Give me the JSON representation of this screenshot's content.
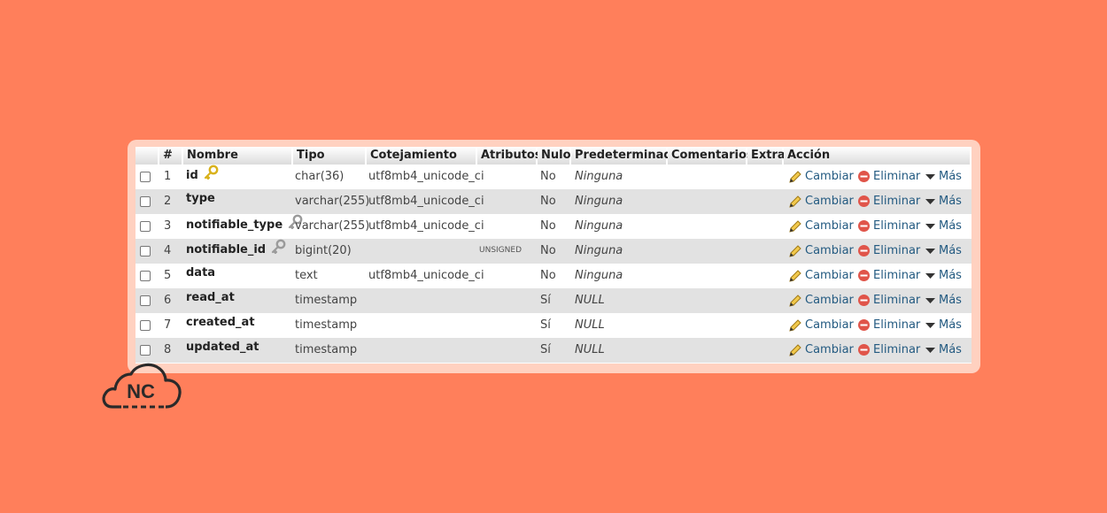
{
  "headers": {
    "hash": "#",
    "nombre": "Nombre",
    "tipo": "Tipo",
    "cotejamiento": "Cotejamiento",
    "atributos": "Atributos",
    "nulo": "Nulo",
    "predeterminado": "Predeterminado",
    "comentarios": "Comentarios",
    "extra": "Extra",
    "accion": "Acción"
  },
  "actions": {
    "cambiar": "Cambiar",
    "eliminar": "Eliminar",
    "mas": "Más"
  },
  "rows": [
    {
      "num": "1",
      "name": "id",
      "tipo": "char(36)",
      "cotejamiento": "utf8mb4_unicode_ci",
      "atributos": "",
      "nulo": "No",
      "predeterminado": "Ninguna",
      "key": "primary"
    },
    {
      "num": "2",
      "name": "type",
      "tipo": "varchar(255)",
      "cotejamiento": "utf8mb4_unicode_ci",
      "atributos": "",
      "nulo": "No",
      "predeterminado": "Ninguna",
      "key": ""
    },
    {
      "num": "3",
      "name": "notifiable_type",
      "tipo": "varchar(255)",
      "cotejamiento": "utf8mb4_unicode_ci",
      "atributos": "",
      "nulo": "No",
      "predeterminado": "Ninguna",
      "key": "index"
    },
    {
      "num": "4",
      "name": "notifiable_id",
      "tipo": "bigint(20)",
      "cotejamiento": "",
      "atributos": "UNSIGNED",
      "nulo": "No",
      "predeterminado": "Ninguna",
      "key": "index"
    },
    {
      "num": "5",
      "name": "data",
      "tipo": "text",
      "cotejamiento": "utf8mb4_unicode_ci",
      "atributos": "",
      "nulo": "No",
      "predeterminado": "Ninguna",
      "key": ""
    },
    {
      "num": "6",
      "name": "read_at",
      "tipo": "timestamp",
      "cotejamiento": "",
      "atributos": "",
      "nulo": "Sí",
      "predeterminado": "NULL",
      "key": ""
    },
    {
      "num": "7",
      "name": "created_at",
      "tipo": "timestamp",
      "cotejamiento": "",
      "atributos": "",
      "nulo": "Sí",
      "predeterminado": "NULL",
      "key": ""
    },
    {
      "num": "8",
      "name": "updated_at",
      "tipo": "timestamp",
      "cotejamiento": "",
      "atributos": "",
      "nulo": "Sí",
      "predeterminado": "NULL",
      "key": ""
    }
  ],
  "logo": {
    "text": "NC"
  },
  "colors": {
    "background": "#ff7f5b",
    "panel": "#ffd1c0",
    "link": "#235a81",
    "primary_key": "#d9b21c",
    "index_key": "#9a9a9a",
    "delete": "#e0554a"
  },
  "icons": {
    "primary_key": "key-icon",
    "index_key": "key-icon",
    "cambiar": "pencil-icon",
    "eliminar": "delete-circle-icon",
    "mas": "triangle-down-icon"
  }
}
